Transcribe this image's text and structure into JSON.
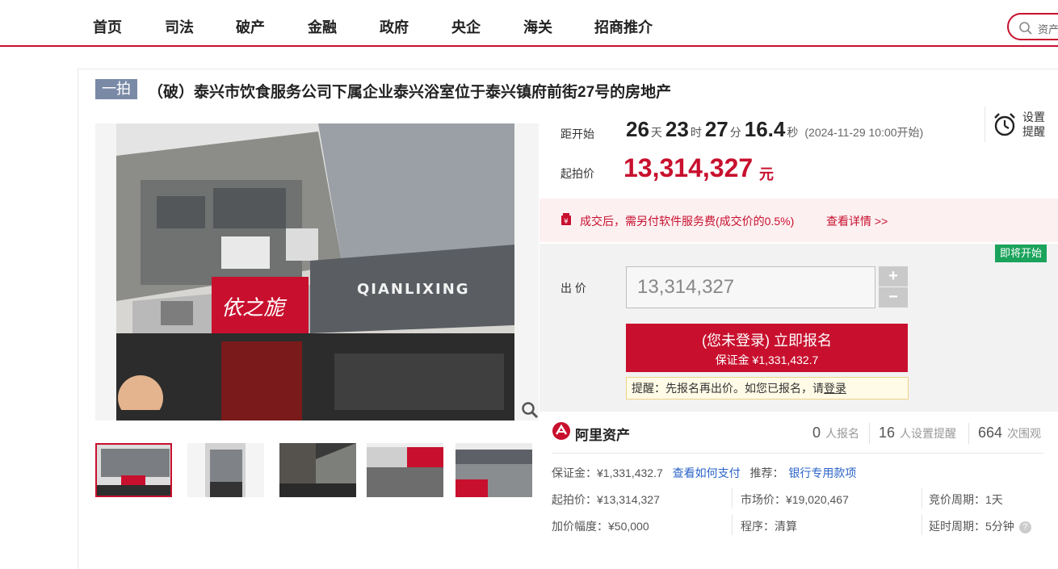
{
  "nav": {
    "items": [
      "首页",
      "司法",
      "破产",
      "金融",
      "政府",
      "央企",
      "海关",
      "招商推介"
    ],
    "search_placeholder": "资产"
  },
  "title": {
    "tag": "一拍",
    "text": "（破）泰兴市饮食服务公司下属企业泰兴浴室位于泰兴镇府前街27号的房地产"
  },
  "countdown": {
    "label": "距开始",
    "days": "26",
    "days_unit": "天",
    "hours": "23",
    "hours_unit": "时",
    "minutes": "27",
    "minutes_unit": "分",
    "seconds": "16.4",
    "seconds_unit": "秒",
    "start_time": "(2024-11-29 10:00开始)"
  },
  "reminder": {
    "label": "设置提醒",
    "icon": "alarm-clock-icon"
  },
  "start_price": {
    "label": "起拍价",
    "value": "13,314,327",
    "unit": "元"
  },
  "fee": {
    "text": "成交后，需另付软件服务费(成交价的0.5%)",
    "link": "查看详情 >>",
    "icon_color": "#c8102e"
  },
  "bid": {
    "status_badge": "即将开始",
    "label": "出 价",
    "input_value": "13,314,327",
    "plus": "+",
    "minus": "−",
    "signup_main": "(您未登录) 立即报名",
    "signup_sub": "保证金 ¥1,331,432.7",
    "tip_prefix": "提醒：先报名再出价。如您已报名，请",
    "tip_link": "登录"
  },
  "platform": {
    "name": "阿里资产"
  },
  "stats": {
    "signups": "0",
    "signups_label": "人报名",
    "reminders": "16",
    "reminders_label": "人设置提醒",
    "views": "664",
    "views_label": "次围观"
  },
  "details": {
    "deposit_label": "保证金：",
    "deposit_value": "¥1,331,432.7",
    "pay_link": "查看如何支付",
    "recommend_label": "推荐：",
    "recommend_link": "银行专用款项",
    "start_price_label": "起拍价：",
    "start_price_value": "¥13,314,327",
    "market_price_label": "市场价：",
    "market_price_value": "¥19,020,467",
    "cycle_label": "竞价周期：",
    "cycle_value": "1天",
    "increment_label": "加价幅度：",
    "increment_value": "¥50,000",
    "procedure_label": "程序：",
    "procedure_value": "清算",
    "extension_label": "延时周期：",
    "extension_value": "5分钟"
  },
  "colors": {
    "brand": "#c8102e",
    "badge": "#1aa35b",
    "tag": "#7a8aa6",
    "link": "#2a63c7"
  },
  "storefront_signs": [
    "QIANLIXING",
    "依之旎"
  ]
}
